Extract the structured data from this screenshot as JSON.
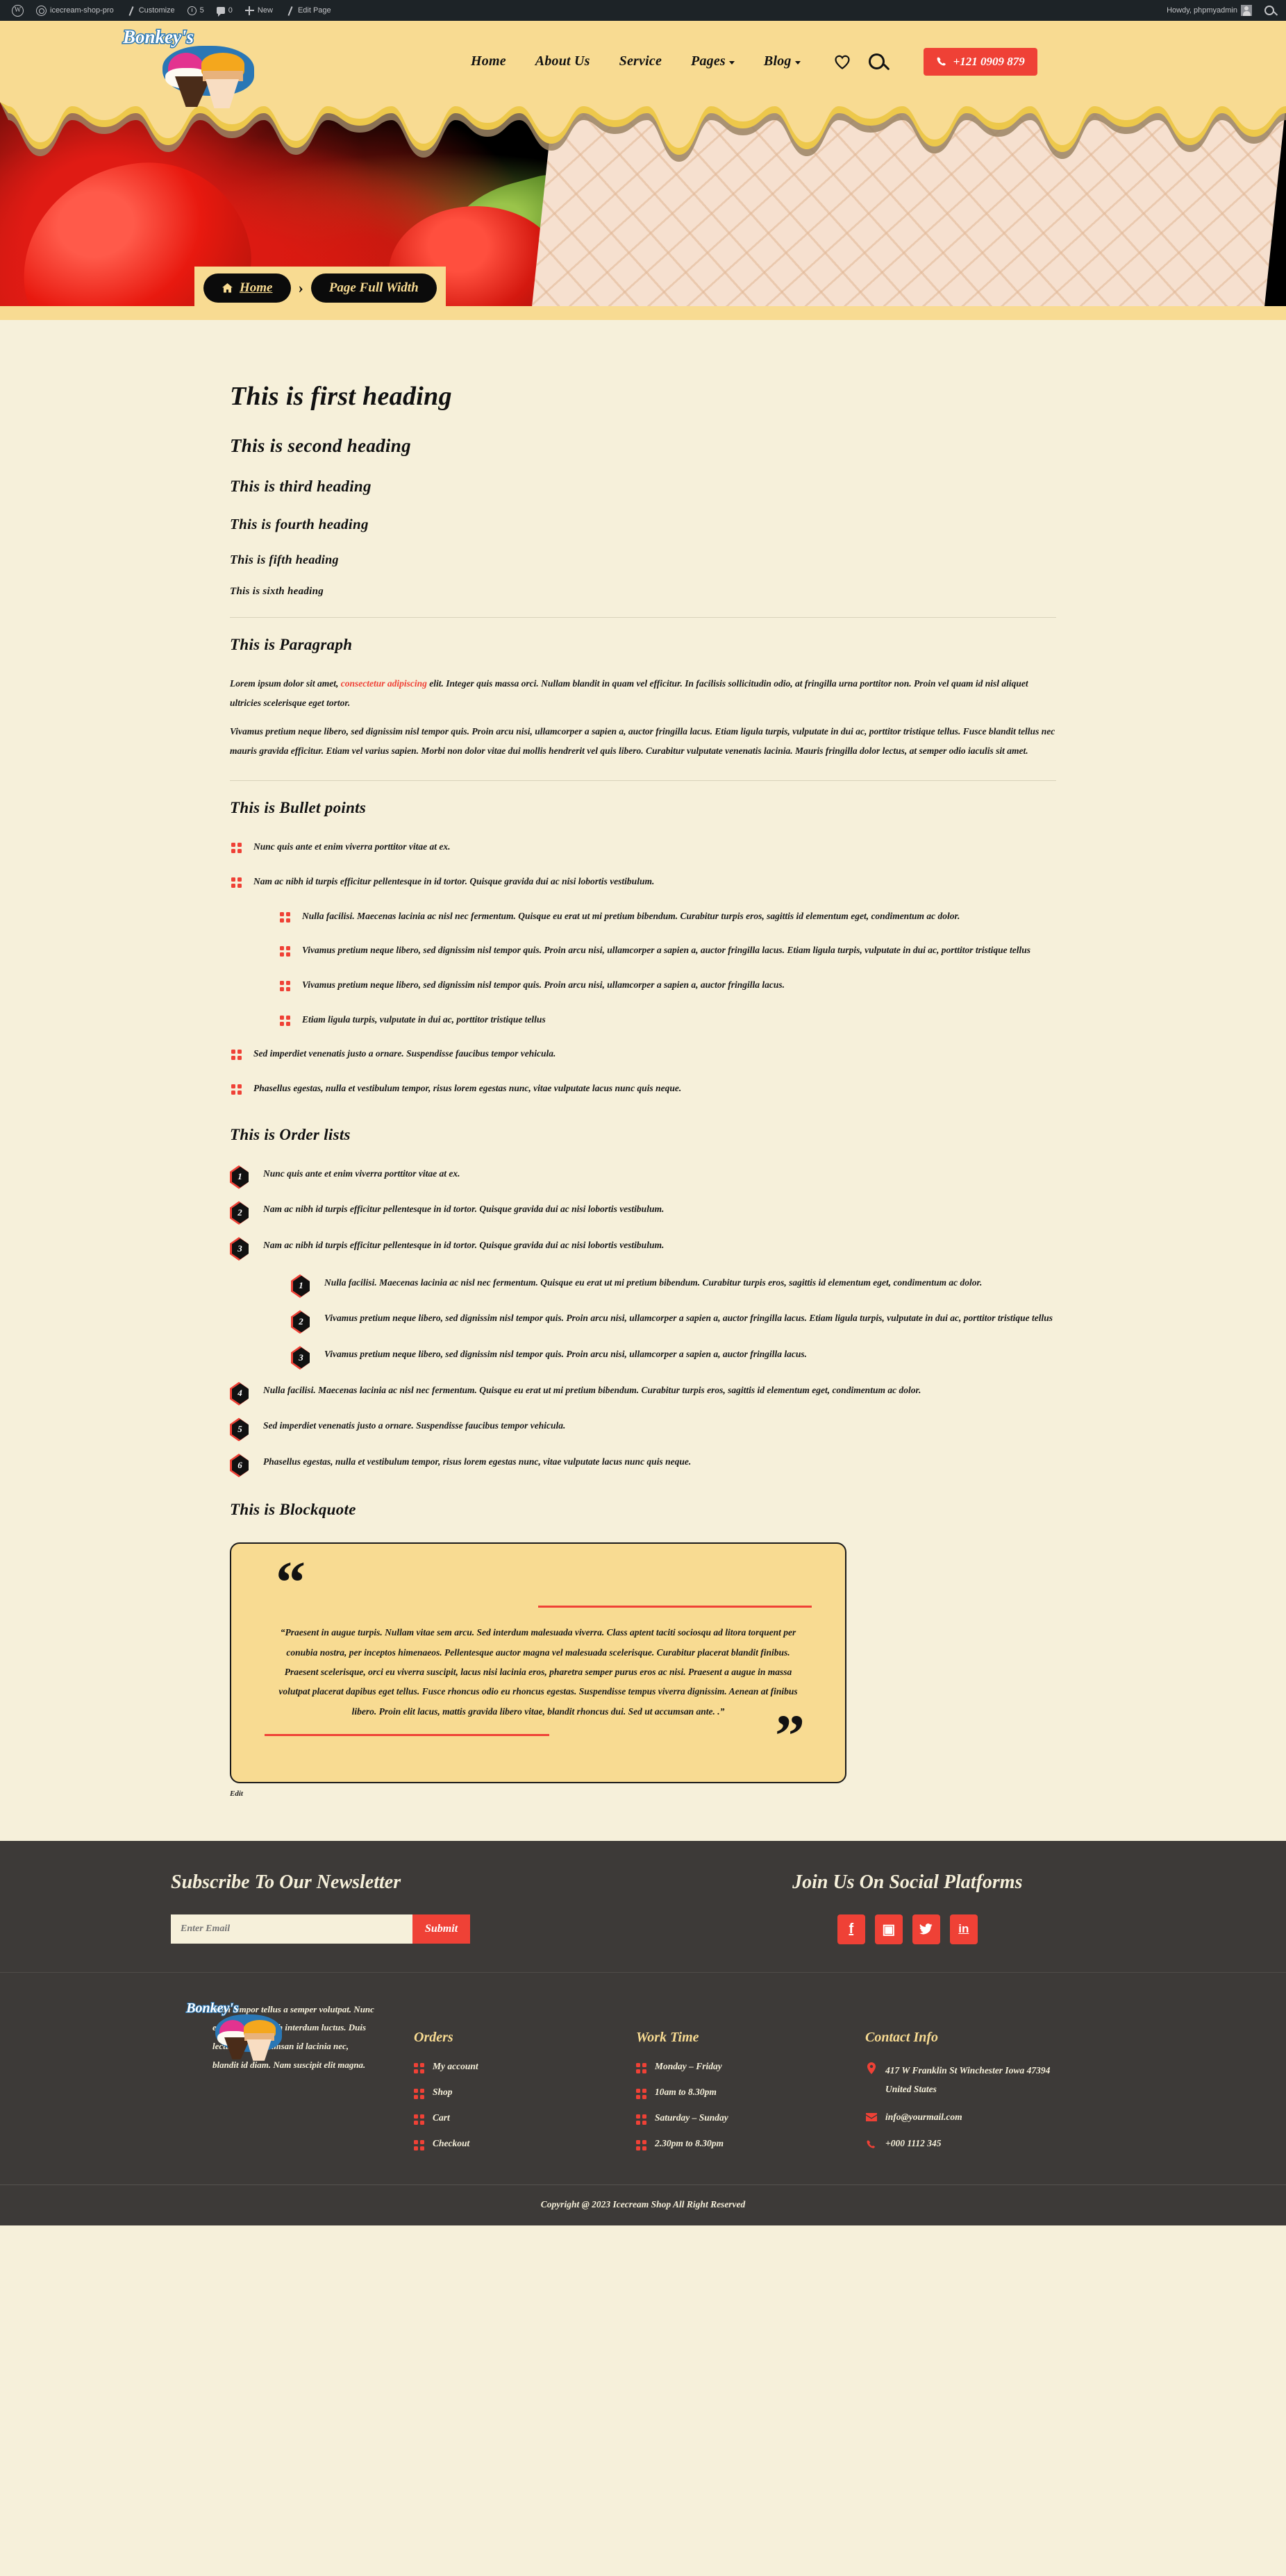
{
  "admin_bar": {
    "items": [
      {
        "icon": "wordpress-logo-icon",
        "label": ""
      },
      {
        "icon": "site-icon",
        "label": "icecream-shop-pro"
      },
      {
        "icon": "pencil-icon",
        "label": "Customize"
      },
      {
        "icon": "revisions-icon",
        "label": "5"
      },
      {
        "icon": "comment-icon",
        "label": "0"
      },
      {
        "icon": "plus-icon",
        "label": "New"
      },
      {
        "icon": "edit-icon",
        "label": "Edit Page"
      }
    ],
    "howdy": "Howdy, phpmyadmin"
  },
  "header": {
    "logo_text": "Bonkey's",
    "nav": [
      {
        "label": "Home",
        "has_dropdown": false
      },
      {
        "label": "About Us",
        "has_dropdown": false
      },
      {
        "label": "Service",
        "has_dropdown": false
      },
      {
        "label": "Pages",
        "has_dropdown": true
      },
      {
        "label": "Blog",
        "has_dropdown": true
      }
    ],
    "phone": "+121 0909 879"
  },
  "hero": {
    "breadcrumb_home": "Home",
    "breadcrumb_current": "Page Full Width"
  },
  "main": {
    "headings": [
      "This is first heading",
      "This is second heading",
      "This is third heading",
      "This is fourth heading",
      "This is fifth heading",
      "This is sixth heading"
    ],
    "paragraph_title": "This is Paragraph",
    "paragraph_1_before": "Lorem ipsum dolor sit amet, ",
    "paragraph_1_link": "consectetur adipiscing",
    "paragraph_1_after": " elit. Integer quis massa orci. Nullam blandit in quam vel efficitur. In facilisis sollicitudin odio, at fringilla urna porttitor non. Proin vel quam id nisl aliquet ultricies scelerisque eget tortor.",
    "paragraph_2": "Vivamus pretium neque libero, sed dignissim nisl tempor quis. Proin arcu nisi, ullamcorper a sapien a, auctor fringilla lacus. Etiam ligula turpis, vulputate in dui ac, porttitor tristique tellus. Fusce blandit tellus nec mauris gravida efficitur. Etiam vel varius sapien. Morbi non dolor vitae dui mollis hendrerit vel quis libero. Curabitur vulputate venenatis lacinia. Mauris fringilla dolor lectus, at semper odio iaculis sit amet.",
    "bullet_title": "This is Bullet points",
    "bullets": [
      "Nunc quis ante et enim viverra porttitor vitae at ex.",
      "Nam ac nibh id turpis efficitur pellentesque in id tortor. Quisque gravida dui ac nisi lobortis vestibulum.",
      "Sed imperdiet venenatis justo a ornare. Suspendisse faucibus tempor vehicula.",
      "Phasellus egestas, nulla et vestibulum tempor, risus lorem egestas nunc, vitae vulputate lacus nunc quis neque."
    ],
    "bullets_nested": [
      "Nulla facilisi. Maecenas lacinia ac nisl nec fermentum. Quisque eu erat ut mi pretium bibendum. Curabitur turpis eros, sagittis id elementum eget, condimentum ac dolor.",
      "Vivamus pretium neque libero, sed dignissim nisl tempor quis. Proin arcu nisi, ullamcorper a sapien a, auctor fringilla lacus. Etiam ligula turpis, vulputate in dui ac, porttitor tristique tellus",
      "Vivamus pretium neque libero, sed dignissim nisl tempor quis. Proin arcu nisi, ullamcorper a sapien a, auctor fringilla lacus.",
      "Etiam ligula turpis, vulputate in dui ac, porttitor tristique tellus"
    ],
    "order_title": "This is Order lists",
    "order_items": [
      "Nunc quis ante et enim viverra porttitor vitae at ex.",
      "Nam ac nibh id turpis efficitur pellentesque in id tortor. Quisque gravida dui ac nisi lobortis vestibulum.",
      "Nam ac nibh id turpis efficitur pellentesque in id tortor. Quisque gravida dui ac nisi lobortis vestibulum.",
      "Nulla facilisi. Maecenas lacinia ac nisl nec fermentum. Quisque eu erat ut mi pretium bibendum. Curabitur turpis eros, sagittis id elementum eget, condimentum ac dolor.",
      "Sed imperdiet venenatis justo a ornare. Suspendisse faucibus tempor vehicula.",
      "Phasellus egestas, nulla et vestibulum tempor, risus lorem egestas nunc, vitae vulputate lacus nunc quis neque."
    ],
    "order_nested": [
      "Nulla facilisi. Maecenas lacinia ac nisl nec fermentum. Quisque eu erat ut mi pretium bibendum. Curabitur turpis eros, sagittis id elementum eget, condimentum ac dolor.",
      "Vivamus pretium neque libero, sed dignissim nisl tempor quis. Proin arcu nisi, ullamcorper a sapien a, auctor fringilla lacus. Etiam ligula turpis, vulputate in dui ac, porttitor tristique tellus",
      "Vivamus pretium neque libero, sed dignissim nisl tempor quis. Proin arcu nisi, ullamcorper a sapien a, auctor fringilla lacus."
    ],
    "blockquote_title": "This is Blockquote",
    "blockquote_open": "“",
    "blockquote_close": "”",
    "blockquote_text": "“Praesent in augue turpis. Nullam vitae sem arcu. Sed interdum malesuada viverra. Class aptent taciti sociosqu ad litora torquent per conubia nostra, per inceptos himenaeos. Pellentesque auctor magna vel malesuada scelerisque. Curabitur placerat blandit finibus. Praesent scelerisque, orci eu viverra suscipit, lacus nisi lacinia eros, pharetra semper purus eros ac nisi. Praesent a augue in massa volutpat placerat dapibus eget tellus. Fusce rhoncus odio eu rhoncus egestas. Suspendisse tempus viverra dignissim. Aenean at finibus libero. Proin elit lacus, mattis gravida libero vitae, blandit rhoncus dui. Sed ut accumsan ante. .”",
    "edit_label": "Edit"
  },
  "newsletter": {
    "title": "Subscribe To Our Newsletter",
    "placeholder": "Enter Email",
    "value": "",
    "submit_label": "Submit",
    "social_title": "Join Us On Social Platforms",
    "socials": [
      {
        "name": "facebook-icon",
        "glyph": "f"
      },
      {
        "name": "instagram-icon",
        "glyph": "▣"
      },
      {
        "name": "twitter-icon",
        "glyph": "ᵥ"
      },
      {
        "name": "linkedin-icon",
        "glyph": "in"
      }
    ]
  },
  "footer": {
    "logo_text": "Bonkey's",
    "about": "Nam tempor tellus a semper volutpat. Nunc euismod vitae nibh interdum luctus. Duis lectus felis, accumsan id lacinia nec, blandit id diam. Nam suscipit elit magna.",
    "orders_title": "Orders",
    "orders": [
      "My account",
      "Shop",
      "Cart",
      "Checkout"
    ],
    "worktime_title": "Work Time",
    "worktime": [
      "Monday – Friday",
      "10am to 8.30pm",
      "Saturday – Sunday",
      "2.30pm to 8.30pm"
    ],
    "contact_title": "Contact Info",
    "contacts": [
      {
        "icon": "location-pin-icon",
        "glyph": "⬤",
        "text": "417 W Franklin St Winchester Iowa 47394 United States"
      },
      {
        "icon": "envelope-icon",
        "glyph": "✉",
        "text": "info@yourmail.com"
      },
      {
        "icon": "phone-icon",
        "glyph": "✆",
        "text": "+000 1112 345"
      }
    ],
    "copyright": "Copyright @ 2023 Icecream Shop All Right Reserved"
  },
  "colors": {
    "accent_red": "#ef4136",
    "brand_yellow": "#f8db92",
    "cream": "#f6f0da",
    "dark": "#3d3a38"
  }
}
